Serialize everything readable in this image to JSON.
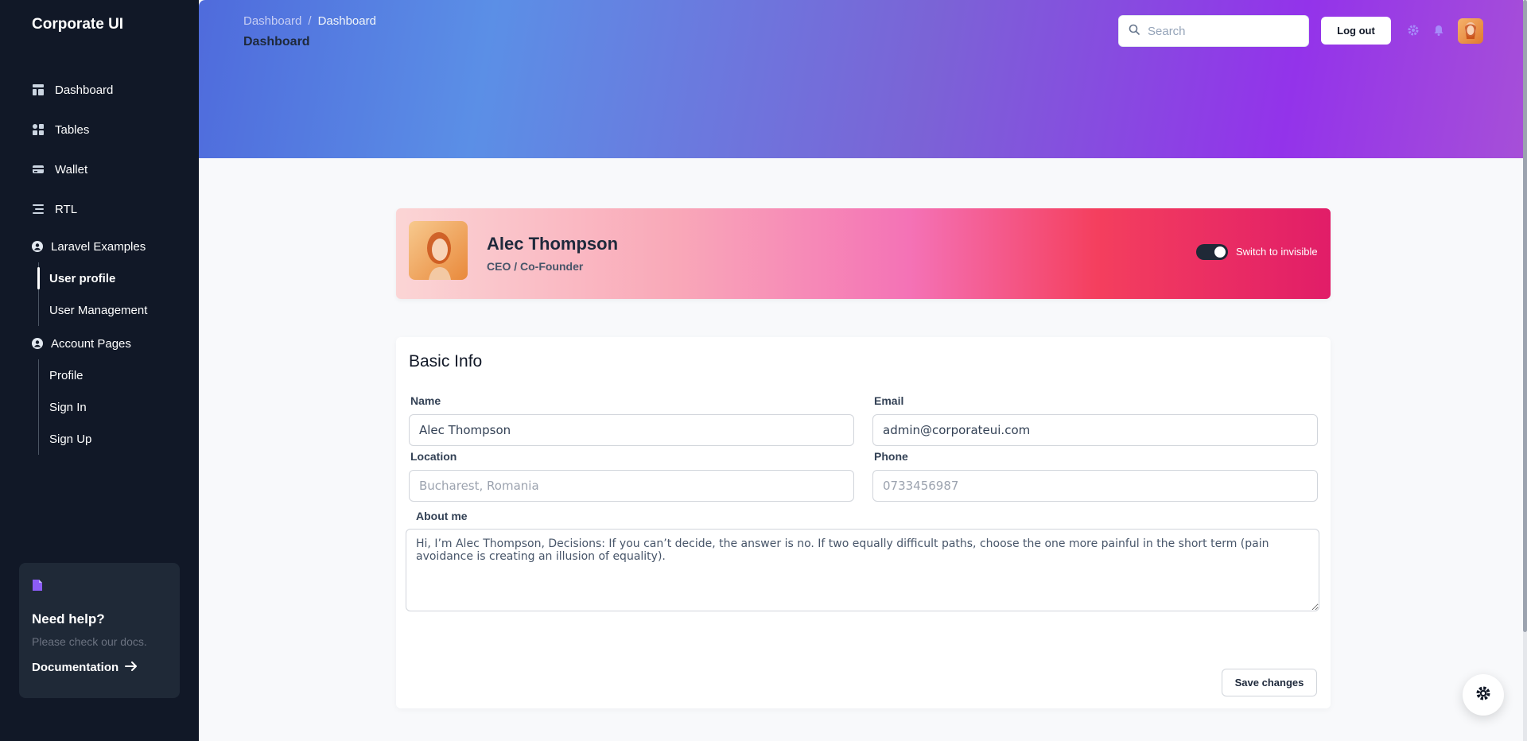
{
  "sidebar": {
    "brand": "Corporate UI",
    "items": [
      {
        "label": "Dashboard",
        "icon": "dashboard-icon"
      },
      {
        "label": "Tables",
        "icon": "tables-icon"
      },
      {
        "label": "Wallet",
        "icon": "wallet-icon"
      },
      {
        "label": "RTL",
        "icon": "rtl-icon"
      }
    ],
    "groups": [
      {
        "label": "Laravel Examples",
        "icon": "user-circle-icon",
        "items": [
          "User profile",
          "User Management"
        ],
        "active": "User profile"
      },
      {
        "label": "Account Pages",
        "icon": "user-circle-icon",
        "items": [
          "Profile",
          "Sign In",
          "Sign Up"
        ]
      }
    ],
    "help": {
      "title": "Need help?",
      "text": "Please check our docs.",
      "link": "Documentation"
    }
  },
  "header": {
    "breadcrumb": [
      "Dashboard",
      "Dashboard"
    ],
    "breadcrumb_sep": "/",
    "title": "Dashboard",
    "search_placeholder": "Search",
    "logout_label": "Log out"
  },
  "profile": {
    "name": "Alec Thompson",
    "role": "CEO / Co-Founder",
    "toggle_label": "Switch to invisible",
    "toggle_on": true
  },
  "basic_info": {
    "title": "Basic Info",
    "name_label": "Name",
    "name_value": "Alec Thompson",
    "email_label": "Email",
    "email_value": "admin@corporateui.com",
    "location_label": "Location",
    "location_placeholder": "Bucharest, Romania",
    "phone_label": "Phone",
    "phone_placeholder": "0733456987",
    "about_label": "About me",
    "about_value": "Hi, I’m Alec Thompson, Decisions: If you can’t decide, the answer is no. If two equally difficult paths, choose the one more painful in the short term (pain avoidance is creating an illusion of equality).",
    "save_label": "Save changes"
  },
  "colors": {
    "sidebar_bg": "#111827",
    "accent": "#9333ea",
    "help_bg": "#1f2937"
  }
}
